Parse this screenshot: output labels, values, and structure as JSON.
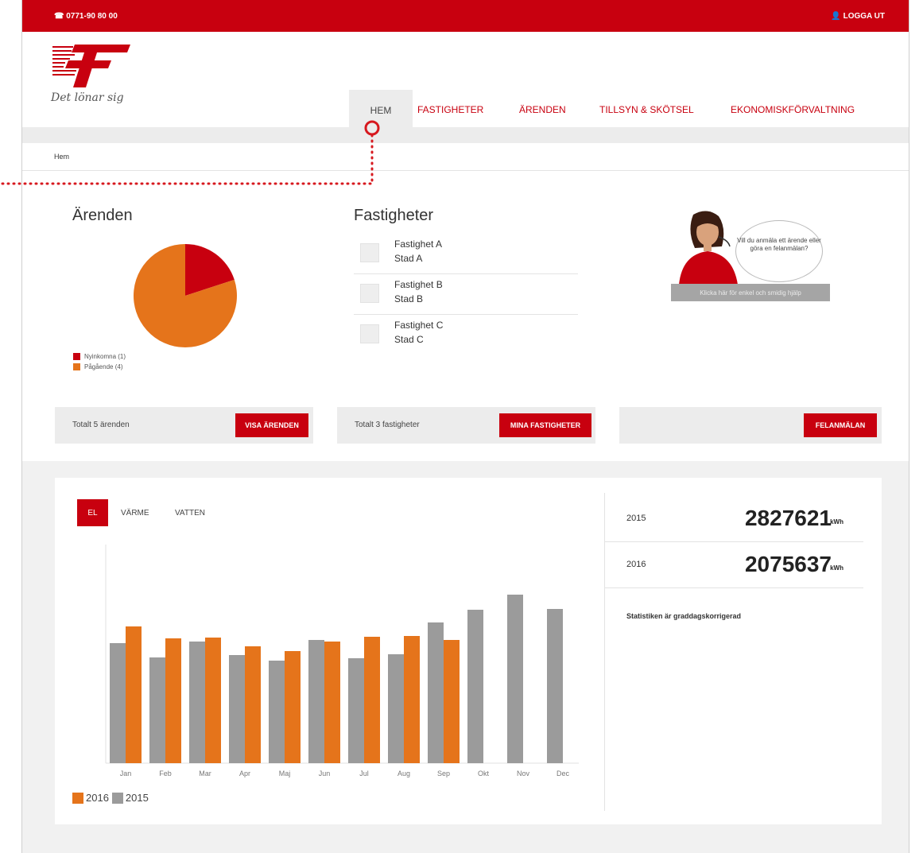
{
  "topbar": {
    "phone": "0771-90 80 00",
    "logout": "LOGGA UT"
  },
  "brand": {
    "slogan": "Det lönar sig"
  },
  "nav": {
    "items": [
      "HEM",
      "FASTIGHETER",
      "ÄRENDEN",
      "TILLSYN & SKÖTSEL",
      "EKONOMISKFÖRVALTNING"
    ]
  },
  "breadcrumb": {
    "current": "Hem"
  },
  "arenden": {
    "title": "Ärenden",
    "legend": [
      {
        "label": "Nyinkomna (1)",
        "value": 1,
        "color": "#c8000f"
      },
      {
        "label": "Pågående (4)",
        "value": 4,
        "color": "#e5741b"
      }
    ],
    "total_label": "Totalt 5 ärenden",
    "button": "VISA ÄRENDEN"
  },
  "fastigheter": {
    "title": "Fastigheter",
    "items": [
      {
        "name": "Fastighet A",
        "city": "Stad A"
      },
      {
        "name": "Fastighet B",
        "city": "Stad B"
      },
      {
        "name": "Fastighet C",
        "city": "Stad C"
      }
    ],
    "total_label": "Totalt 3 fastigheter",
    "button": "MINA FASTIGHETER"
  },
  "help": {
    "bubble": "Vill du anmäla ett ärende eller göra en felanmälan?",
    "bar": "Klicka här för enkel och smidig hjälp",
    "button": "FELANMÄLAN"
  },
  "energy": {
    "tabs": [
      "EL",
      "VÄRME",
      "VATTEN"
    ],
    "active_tab": "EL",
    "stats": [
      {
        "year": "2015",
        "value": "2827621",
        "unit": "kWh"
      },
      {
        "year": "2016",
        "value": "2075637",
        "unit": "kWh"
      }
    ],
    "note": "Statistiken är graddagskorrigerad"
  },
  "chart_data": {
    "type": "bar",
    "categories": [
      "Jan",
      "Feb",
      "Mar",
      "Apr",
      "Maj",
      "Jun",
      "Jul",
      "Aug",
      "Sep",
      "Okt",
      "Nov",
      "Dec"
    ],
    "series": [
      {
        "name": "2015",
        "color": "#9b9b9b",
        "values": [
          151,
          133,
          153,
          136,
          129,
          155,
          132,
          137,
          177,
          193,
          212,
          194
        ]
      },
      {
        "name": "2016",
        "color": "#e5741b",
        "values": [
          172,
          157,
          158,
          147,
          141,
          153,
          159,
          160,
          155,
          null,
          null,
          null
        ]
      }
    ],
    "ylim": [
      0,
      280
    ],
    "grid": false,
    "legend": "bottom-left",
    "legend_order": [
      "2016",
      "2015"
    ]
  },
  "colors": {
    "brand_red": "#c8000f",
    "orange": "#e5741b",
    "gray_bar": "#9b9b9b"
  }
}
